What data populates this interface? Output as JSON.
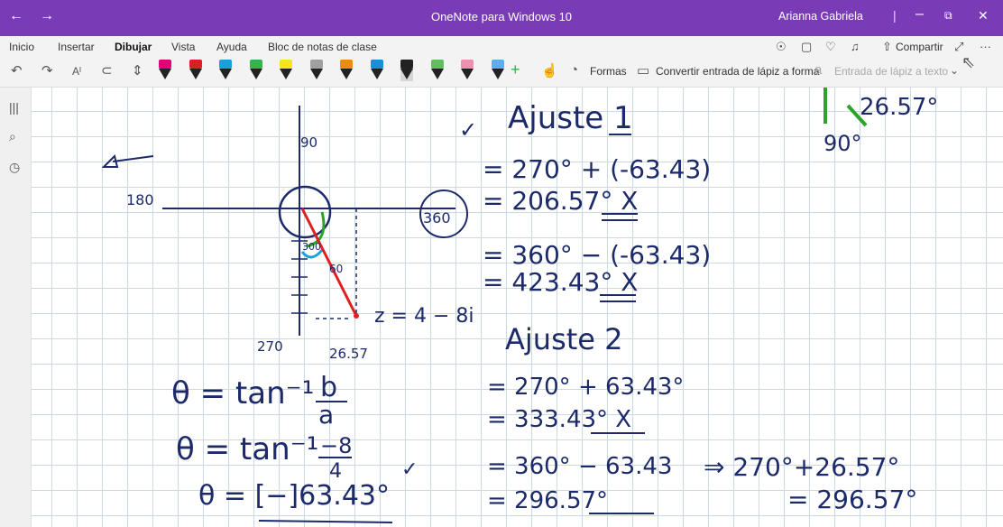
{
  "window": {
    "back_glyph": "←",
    "forward_glyph": "→",
    "title": "OneNote para Windows 10",
    "user": "Arianna Gabriela",
    "separator": "|",
    "minimize_glyph": "–",
    "restore_glyph": "⧉",
    "close_glyph": "✕"
  },
  "ribbon_tabs": {
    "inicio": "Inicio",
    "insertar": "Insertar",
    "dibujar": "Dibujar",
    "vista": "Vista",
    "ayuda": "Ayuda",
    "bloc": "Bloc de notas de clase"
  },
  "ribbon_right": {
    "share_label": "Compartir",
    "more_glyph": "···"
  },
  "toolbar": {
    "formas_label": "Formas",
    "convert_label": "Convertir entrada de lápiz a forma",
    "ink_to_text_label": "Entrada de lápiz a texto",
    "add_glyph": "+"
  },
  "pen_colors": [
    "#e0007a",
    "#d92020",
    "#1aa0d8",
    "#38b24a",
    "#f5e61a",
    "#a0a0a0",
    "#ee8a16",
    "#1a8fd8",
    "#222222",
    "#5fc15a",
    "#f08fb0",
    "#5ab0e8"
  ],
  "handwriting": {
    "ajuste1": "Ajuste 1",
    "a1_line1": "= 270° + (-63.43)",
    "a1_line2": "= 206.57°  X",
    "a1_line3": "= 360° − (-63.43)",
    "a1_line4": "= 423.43°  X",
    "ajuste2": "Ajuste 2",
    "a2_line1": "= 270° + 63.43°",
    "a2_line2": "= 333.43°  X",
    "a2_line3": "= 360° − 63.43",
    "a2_line4": "= 296.57°",
    "right_line1": "⇒ 270°+26.57°",
    "right_line2": "= 296.57°",
    "top_right_angle": "26.57°",
    "top_right_90": "90°",
    "theta1": "θ = tan⁻¹",
    "theta1_num": "b",
    "theta1_den": "a",
    "theta2": "θ = tan⁻¹",
    "theta2_num": "−8",
    "theta2_den": "4",
    "theta3": "θ = [−]63.43°",
    "label_90": "90",
    "label_180": "180",
    "label_360": "360",
    "label_270": "270",
    "label_2657": "26.57",
    "label_z": "z = 4 − 8i",
    "label_300": "300",
    "label_60": "60",
    "check": "✓",
    "check2": "✓"
  },
  "colors": {
    "accent": "#7a3bb6",
    "ink": "#1c2a6a",
    "red": "#e02020",
    "green": "#2aa52a",
    "grid": "#c9d8ee"
  }
}
